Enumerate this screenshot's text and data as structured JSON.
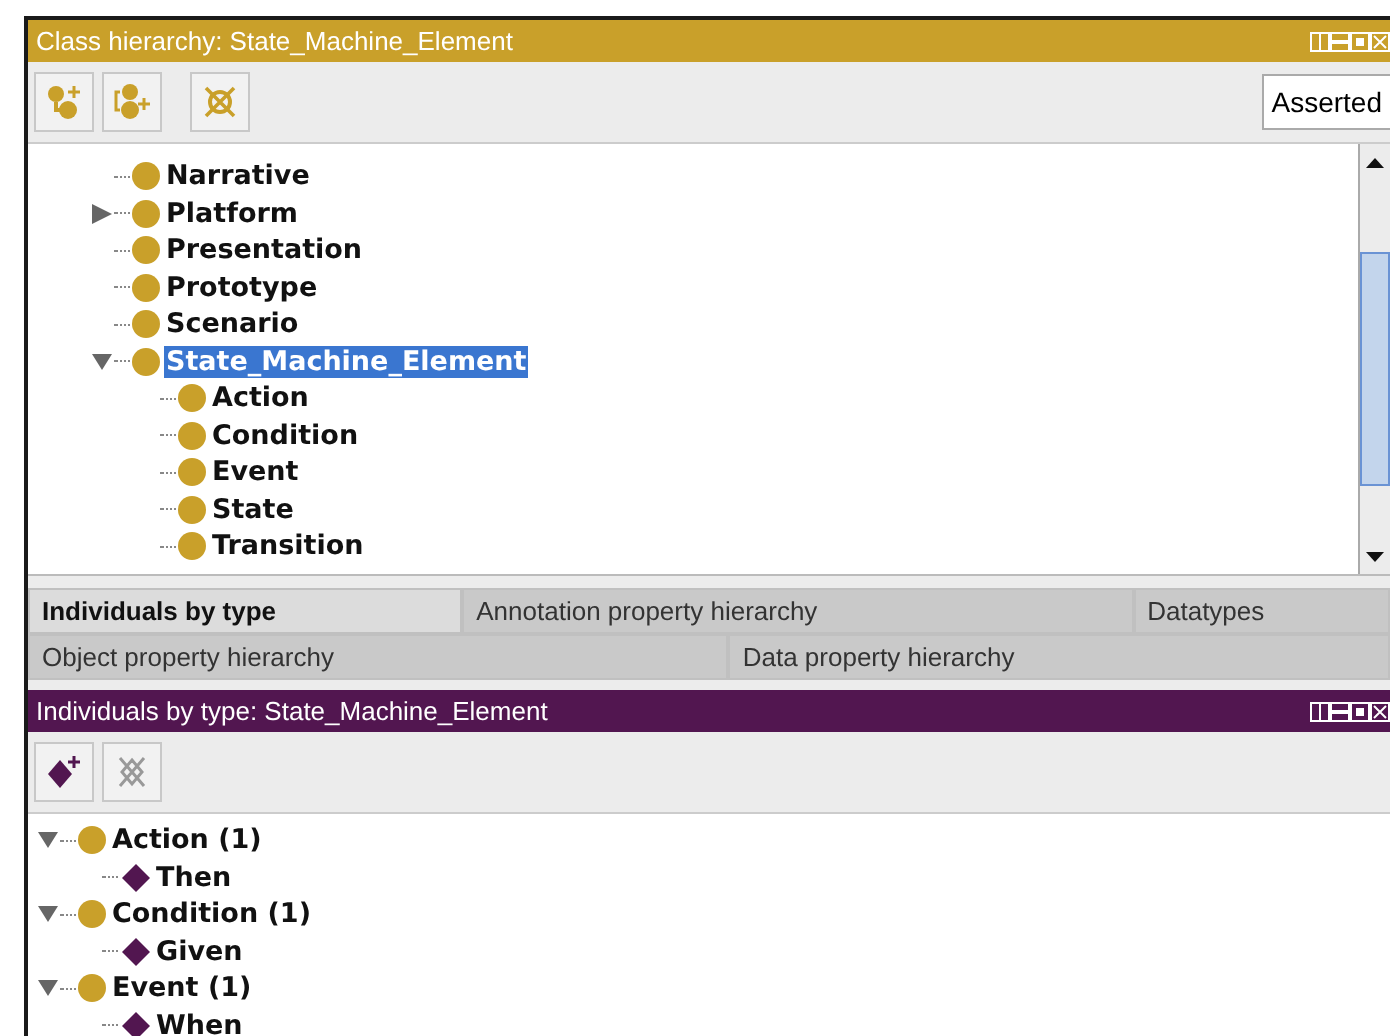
{
  "class_panel": {
    "title": "Class hierarchy: State_Machine_Element",
    "view_dropdown": "Asserted",
    "tree": [
      {
        "label": "Narrative",
        "selected": false
      },
      {
        "label": "Platform",
        "selected": false,
        "expanded": false
      },
      {
        "label": "Presentation",
        "selected": false
      },
      {
        "label": "Prototype",
        "selected": false
      },
      {
        "label": "Scenario",
        "selected": false
      },
      {
        "label": "State_Machine_Element",
        "selected": true,
        "expanded": true,
        "children": [
          {
            "label": "Action",
            "selected": false
          },
          {
            "label": "Condition",
            "selected": false
          },
          {
            "label": "Event",
            "selected": false
          },
          {
            "label": "State",
            "selected": false
          },
          {
            "label": "Transition",
            "selected": false
          }
        ]
      }
    ]
  },
  "tabs": [
    [
      {
        "label": "Individuals by type",
        "selected": true
      },
      {
        "label": "Annotation property hierarchy",
        "selected": false
      },
      {
        "label": "Datatypes",
        "selected": false
      }
    ],
    [
      {
        "label": "Object property hierarchy",
        "selected": false
      },
      {
        "label": "Data property hierarchy",
        "selected": false
      }
    ]
  ],
  "individuals_panel": {
    "title": "Individuals by type: State_Machine_Element",
    "tree": [
      {
        "kind": "class",
        "label": "Action (1)",
        "expanded": true,
        "children": [
          {
            "kind": "individual",
            "label": "Then"
          }
        ]
      },
      {
        "kind": "class",
        "label": "Condition (1)",
        "expanded": true,
        "children": [
          {
            "kind": "individual",
            "label": "Given"
          }
        ]
      },
      {
        "kind": "class",
        "label": "Event (1)",
        "expanded": true,
        "children": [
          {
            "kind": "individual",
            "label": "When"
          }
        ]
      }
    ]
  }
}
